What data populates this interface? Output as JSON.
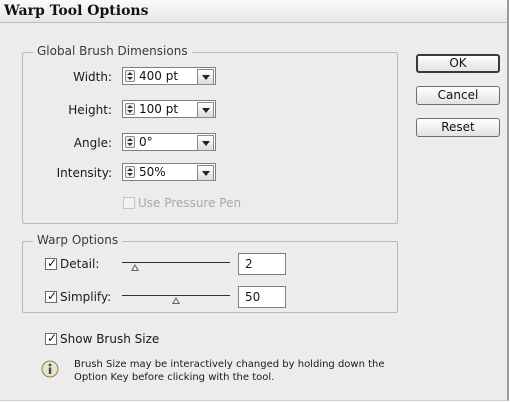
{
  "window": {
    "title": "Warp Tool Options"
  },
  "global_brush": {
    "legend": "Global Brush Dimensions",
    "fields": [
      {
        "label": "Width:",
        "value": "400 pt"
      },
      {
        "label": "Height:",
        "value": "100 pt"
      },
      {
        "label": "Angle:",
        "value": "0°"
      },
      {
        "label": "Intensity:",
        "value": "50%"
      }
    ],
    "use_pressure_pen": {
      "label": "Use Pressure Pen",
      "checked": false,
      "enabled": false
    }
  },
  "warp_options": {
    "legend": "Warp Options",
    "detail": {
      "label": "Detail:",
      "checked": true,
      "value": "2",
      "slider_fraction": 0.12
    },
    "simplify": {
      "label": "Simplify:",
      "checked": true,
      "value": "50",
      "slider_fraction": 0.5
    }
  },
  "show_brush_size": {
    "label": "Show Brush Size",
    "checked": true
  },
  "info": {
    "icon": "info-icon",
    "line1": "Brush Size may be interactively changed by holding down the",
    "line2": "Option Key before clicking with the tool."
  },
  "buttons": {
    "ok": "OK",
    "cancel": "Cancel",
    "reset": "Reset"
  },
  "check_glyph": "✓"
}
